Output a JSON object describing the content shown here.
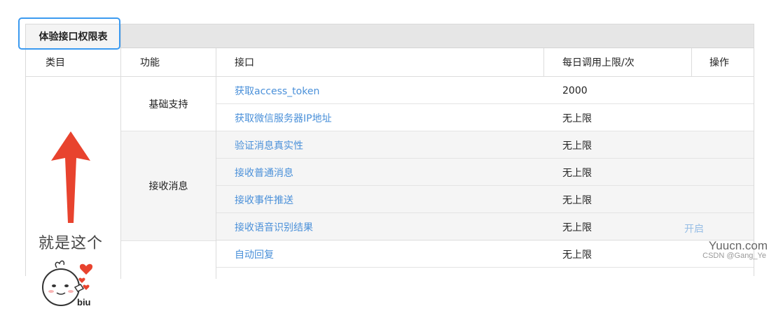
{
  "tab": {
    "label": "体验接口权限表"
  },
  "headers": {
    "category": "类目",
    "function": "功能",
    "api": "接口",
    "limit": "每日调用上限/次",
    "action": "操作"
  },
  "categories": {
    "annotation": "就是这个",
    "sticker_text": "biu"
  },
  "groups": [
    {
      "name": "基础支持"
    },
    {
      "name": "接收消息"
    }
  ],
  "rows": [
    {
      "api": "获取access_token",
      "limit": "2000"
    },
    {
      "api": "获取微信服务器IP地址",
      "limit": "无上限"
    },
    {
      "api": "验证消息真实性",
      "limit": "无上限"
    },
    {
      "api": "接收普通消息",
      "limit": "无上限"
    },
    {
      "api": "接收事件推送",
      "limit": "无上限"
    },
    {
      "api": "接收语音识别结果",
      "limit": "无上限",
      "action": "开启"
    },
    {
      "api": "自动回复",
      "limit": "无上限"
    }
  ],
  "watermark": {
    "site": "Yuucn.com",
    "credit": "CSDN @Gang_Ye"
  },
  "colors": {
    "link": "#4a90d9",
    "highlight": "#3b9af0",
    "arrow": "#e8432e"
  }
}
